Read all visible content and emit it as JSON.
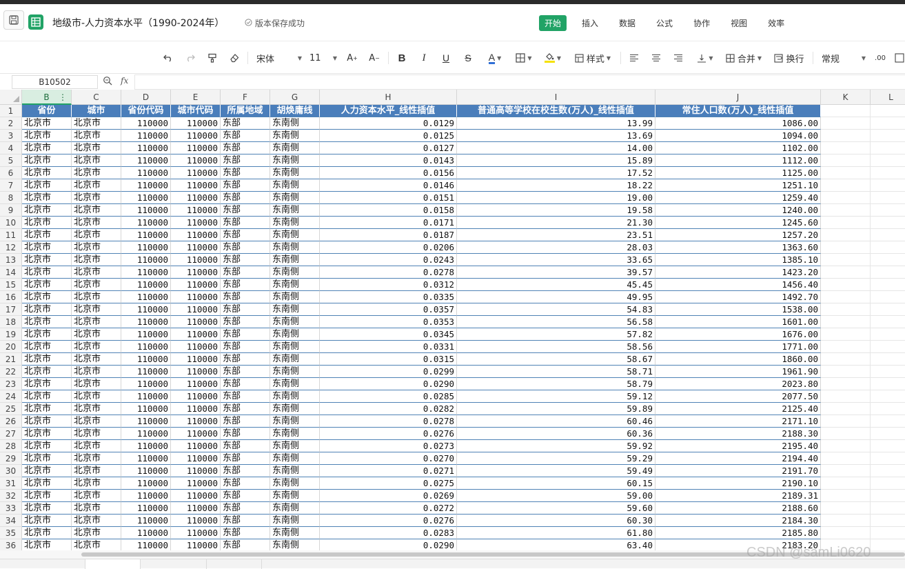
{
  "titlebar": {
    "doc_title": "地级市-人力资本水平（1990-2024年）",
    "save_status": "版本保存成功"
  },
  "menu": {
    "tabs": [
      "开始",
      "插入",
      "数据",
      "公式",
      "协作",
      "视图",
      "效率"
    ],
    "active": "开始"
  },
  "toolbar": {
    "font_name": "宋体",
    "font_size": "11",
    "style_label": "样式",
    "merge_label": "合并",
    "wrap_label": "换行",
    "number_format": "常规",
    "font_color": "#2f6fd6",
    "fill_color": "#f5e100"
  },
  "formula_bar": {
    "cell_ref": "B10502",
    "fx": "fx",
    "value": ""
  },
  "sheet": {
    "columns": [
      "B",
      "C",
      "D",
      "E",
      "F",
      "G",
      "H",
      "I",
      "J",
      "K",
      "L"
    ],
    "selected_column": "B",
    "header_row": [
      "省份",
      "城市",
      "省份代码",
      "城市代码",
      "所属地域",
      "胡焕庸线",
      "人力资本水平_线性插值",
      "普通高等学校在校生数(万人)_线性插值",
      "常住人口数(万人)_线性插值"
    ],
    "row_numbers": [
      "1",
      "2",
      "3",
      "4",
      "5",
      "6",
      "7",
      "8",
      "9",
      "10",
      "11",
      "12",
      "13",
      "14",
      "15",
      "16",
      "17",
      "18",
      "19",
      "20",
      "21",
      "22",
      "23",
      "24",
      "25",
      "26",
      "27",
      "28",
      "29",
      "30",
      "31",
      "32",
      "33",
      "34",
      "35",
      "36"
    ],
    "rows": [
      [
        "北京市",
        "北京市",
        "110000",
        "110000",
        "东部",
        "东南侧",
        "0.0129",
        "13.99",
        "1086.00"
      ],
      [
        "北京市",
        "北京市",
        "110000",
        "110000",
        "东部",
        "东南侧",
        "0.0125",
        "13.69",
        "1094.00"
      ],
      [
        "北京市",
        "北京市",
        "110000",
        "110000",
        "东部",
        "东南侧",
        "0.0127",
        "14.00",
        "1102.00"
      ],
      [
        "北京市",
        "北京市",
        "110000",
        "110000",
        "东部",
        "东南侧",
        "0.0143",
        "15.89",
        "1112.00"
      ],
      [
        "北京市",
        "北京市",
        "110000",
        "110000",
        "东部",
        "东南侧",
        "0.0156",
        "17.52",
        "1125.00"
      ],
      [
        "北京市",
        "北京市",
        "110000",
        "110000",
        "东部",
        "东南侧",
        "0.0146",
        "18.22",
        "1251.10"
      ],
      [
        "北京市",
        "北京市",
        "110000",
        "110000",
        "东部",
        "东南侧",
        "0.0151",
        "19.00",
        "1259.40"
      ],
      [
        "北京市",
        "北京市",
        "110000",
        "110000",
        "东部",
        "东南侧",
        "0.0158",
        "19.58",
        "1240.00"
      ],
      [
        "北京市",
        "北京市",
        "110000",
        "110000",
        "东部",
        "东南侧",
        "0.0171",
        "21.30",
        "1245.60"
      ],
      [
        "北京市",
        "北京市",
        "110000",
        "110000",
        "东部",
        "东南侧",
        "0.0187",
        "23.51",
        "1257.20"
      ],
      [
        "北京市",
        "北京市",
        "110000",
        "110000",
        "东部",
        "东南侧",
        "0.0206",
        "28.03",
        "1363.60"
      ],
      [
        "北京市",
        "北京市",
        "110000",
        "110000",
        "东部",
        "东南侧",
        "0.0243",
        "33.65",
        "1385.10"
      ],
      [
        "北京市",
        "北京市",
        "110000",
        "110000",
        "东部",
        "东南侧",
        "0.0278",
        "39.57",
        "1423.20"
      ],
      [
        "北京市",
        "北京市",
        "110000",
        "110000",
        "东部",
        "东南侧",
        "0.0312",
        "45.45",
        "1456.40"
      ],
      [
        "北京市",
        "北京市",
        "110000",
        "110000",
        "东部",
        "东南侧",
        "0.0335",
        "49.95",
        "1492.70"
      ],
      [
        "北京市",
        "北京市",
        "110000",
        "110000",
        "东部",
        "东南侧",
        "0.0357",
        "54.83",
        "1538.00"
      ],
      [
        "北京市",
        "北京市",
        "110000",
        "110000",
        "东部",
        "东南侧",
        "0.0353",
        "56.58",
        "1601.00"
      ],
      [
        "北京市",
        "北京市",
        "110000",
        "110000",
        "东部",
        "东南侧",
        "0.0345",
        "57.82",
        "1676.00"
      ],
      [
        "北京市",
        "北京市",
        "110000",
        "110000",
        "东部",
        "东南侧",
        "0.0331",
        "58.56",
        "1771.00"
      ],
      [
        "北京市",
        "北京市",
        "110000",
        "110000",
        "东部",
        "东南侧",
        "0.0315",
        "58.67",
        "1860.00"
      ],
      [
        "北京市",
        "北京市",
        "110000",
        "110000",
        "东部",
        "东南侧",
        "0.0299",
        "58.71",
        "1961.90"
      ],
      [
        "北京市",
        "北京市",
        "110000",
        "110000",
        "东部",
        "东南侧",
        "0.0290",
        "58.79",
        "2023.80"
      ],
      [
        "北京市",
        "北京市",
        "110000",
        "110000",
        "东部",
        "东南侧",
        "0.0285",
        "59.12",
        "2077.50"
      ],
      [
        "北京市",
        "北京市",
        "110000",
        "110000",
        "东部",
        "东南侧",
        "0.0282",
        "59.89",
        "2125.40"
      ],
      [
        "北京市",
        "北京市",
        "110000",
        "110000",
        "东部",
        "东南侧",
        "0.0278",
        "60.46",
        "2171.10"
      ],
      [
        "北京市",
        "北京市",
        "110000",
        "110000",
        "东部",
        "东南侧",
        "0.0276",
        "60.36",
        "2188.30"
      ],
      [
        "北京市",
        "北京市",
        "110000",
        "110000",
        "东部",
        "东南侧",
        "0.0273",
        "59.92",
        "2195.40"
      ],
      [
        "北京市",
        "北京市",
        "110000",
        "110000",
        "东部",
        "东南侧",
        "0.0270",
        "59.29",
        "2194.40"
      ],
      [
        "北京市",
        "北京市",
        "110000",
        "110000",
        "东部",
        "东南侧",
        "0.0271",
        "59.49",
        "2191.70"
      ],
      [
        "北京市",
        "北京市",
        "110000",
        "110000",
        "东部",
        "东南侧",
        "0.0275",
        "60.15",
        "2190.10"
      ],
      [
        "北京市",
        "北京市",
        "110000",
        "110000",
        "东部",
        "东南侧",
        "0.0269",
        "59.00",
        "2189.31"
      ],
      [
        "北京市",
        "北京市",
        "110000",
        "110000",
        "东部",
        "东南侧",
        "0.0272",
        "59.60",
        "2188.60"
      ],
      [
        "北京市",
        "北京市",
        "110000",
        "110000",
        "东部",
        "东南侧",
        "0.0276",
        "60.30",
        "2184.30"
      ],
      [
        "北京市",
        "北京市",
        "110000",
        "110000",
        "东部",
        "东南侧",
        "0.0283",
        "61.80",
        "2185.80"
      ],
      [
        "北京市",
        "北京市",
        "110000",
        "110000",
        "东部",
        "东南侧",
        "0.0290",
        "63.40",
        "2183.20"
      ]
    ],
    "numeric_columns": [
      2,
      3,
      6,
      7,
      8
    ]
  },
  "watermark": "CSDN @samLi0620"
}
